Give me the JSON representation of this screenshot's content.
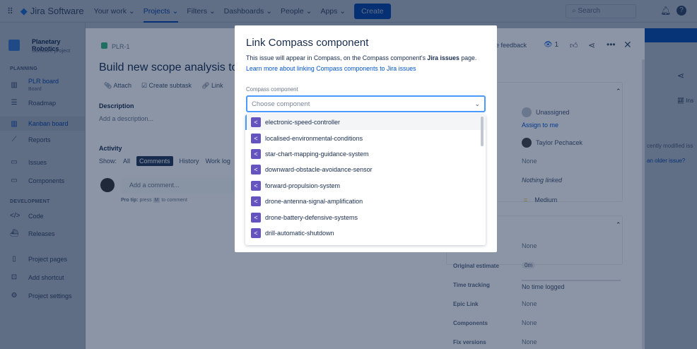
{
  "nav": {
    "app": "Jira Software",
    "items": [
      "Your work",
      "Projects",
      "Filters",
      "Dashboards",
      "People",
      "Apps"
    ],
    "create": "Create",
    "search": "Search"
  },
  "project": {
    "name": "Planetary Robotics",
    "type": "Software project"
  },
  "sidebar": {
    "planning": "PLANNING",
    "board": "PLR board",
    "board_sub": "Board",
    "items": [
      "Roadmap",
      "Kanban board",
      "Reports",
      "Issues",
      "Components"
    ],
    "development": "DEVELOPMENT",
    "dev_items": [
      "Code",
      "Releases"
    ],
    "bottom": [
      "Project pages",
      "Add shortcut",
      "Project settings"
    ]
  },
  "issue": {
    "key": "PLR-1",
    "title": "Build new scope analysis to de",
    "actions": [
      "Attach",
      "Create subtask",
      "Link"
    ],
    "description_label": "Description",
    "description_placeholder": "Add a description...",
    "activity": "Activity",
    "show": "Show:",
    "filters": [
      "All",
      "Comments",
      "History",
      "Work log"
    ],
    "comment_placeholder": "Add a comment...",
    "protip": "Pro tip:",
    "protip_text": "press",
    "protip_key": "M",
    "protip_end": "to comment",
    "feedback": "e feedback",
    "watchers": "1"
  },
  "details": {
    "assignee": "Unassigned",
    "assign_me": "Assign to me",
    "reporter": "Taylor Pechacek",
    "labels": "None",
    "linked": "Nothing linked",
    "priority": "Medium",
    "rows": [
      {
        "label": "",
        "value": "None"
      },
      {
        "label": "Original estimate",
        "value": "0m"
      },
      {
        "label": "Time tracking",
        "value": "No time logged"
      },
      {
        "label": "Epic Link",
        "value": "None"
      },
      {
        "label": "Components",
        "value": "None"
      },
      {
        "label": "Fix versions",
        "value": "None"
      }
    ]
  },
  "background": {
    "recent": "cently modified iss",
    "older": "an older issue?",
    "insights": "Ins"
  },
  "modal": {
    "title": "Link Compass component",
    "desc_pre": "This issue will appear in Compass, on the Compass component's ",
    "desc_bold": "Jira issues",
    "desc_post": " page.",
    "link": "Learn more about linking Compass components to Jira issues",
    "field_label": "Compass component",
    "placeholder": "Choose component",
    "options": [
      "electronic-speed-controller",
      "localised-environmental-conditions",
      "star-chart-mapping-guidance-system",
      "downward-obstacle-avoidance-sensor",
      "forward-propulsion-system",
      "drone-antenna-signal-amplification",
      "drone-battery-defensive-systems",
      "drill-automatic-shutdown"
    ]
  }
}
